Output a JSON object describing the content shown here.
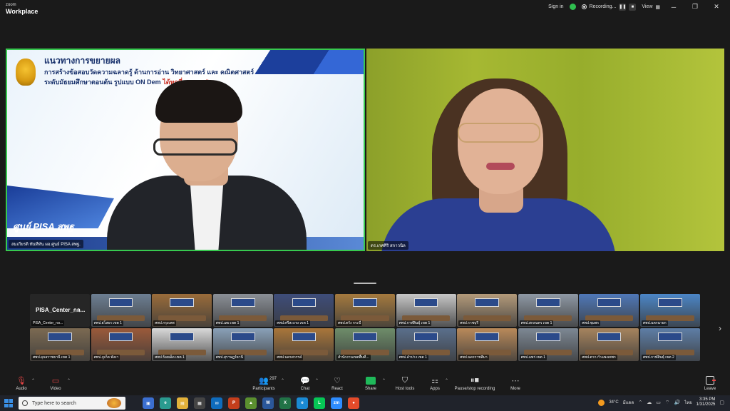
{
  "window": {
    "brand_small": "zoom",
    "brand_large": "Workplace",
    "sign_in": "Sign in",
    "recording": "Recording...",
    "view": "View"
  },
  "main_tiles": [
    {
      "slide_title": "แนวทางการขยายผล",
      "slide_line2": "การสร้างข้อสอบวัดความฉลาดรู้ ด้านการอ่าน วิทยาศาสตร์ และ คณิตศาสตร์",
      "slide_line3": "ระดับมัธยมศึกษาตอนต้น รูปแบบ ON Dem",
      "slide_line3_highlight": "ได้ทุกที่ ทุกเวลา\"",
      "slide_banner": "ศูนย์ PISA สพฐ.",
      "name": "สมเกียรติ ทันทีทัน ผอ.ศูนย์ PISA สพฐ."
    },
    {
      "name": "ดร.เกศศิริ สกาวนิล"
    }
  ],
  "gallery": [
    {
      "label": "PISA_Center_กล...",
      "text_only": true,
      "name": "PISA_Center_กล..."
    },
    {
      "label": "ศพป.ยโสธร เขต 1",
      "color": "#6d7f93"
    },
    {
      "label": "ศพป.กรุงเทพ",
      "color": "#9a6c3a"
    },
    {
      "label": "ศพป.เลย เขต 1",
      "color": "#8a8f96"
    },
    {
      "label": "ศพป.ศรีสะเกษ เขต 1",
      "color": "#3e4d7a"
    },
    {
      "label": "ศพป.ตรัง กระบี่",
      "color": "#a57a3e"
    },
    {
      "label": "ศพป.กาฬสินธุ์ เขต 1",
      "color": "#c6c6c6"
    },
    {
      "label": "ศพป.ราชบุรี",
      "color": "#b39a7a"
    },
    {
      "label": "ศพป.สกลนคร เขต 1",
      "color": "#8e98a4"
    },
    {
      "label": "ศพป.ชุมพร",
      "color": "#4f78b8"
    },
    {
      "label": "ศพป.นครนายก",
      "color": "#4b86c7"
    },
    {
      "label": "ศพป.อุบลราชธานี เขต 1",
      "color": "#7c6a52"
    },
    {
      "label": "ศพป.ภูเก็ต พังงา",
      "color": "#9b5a3a"
    },
    {
      "label": "ศพป.ร้อยเอ็ด เขต 1",
      "color": "#d9d9d9"
    },
    {
      "label": "ศพป.สุราษฎร์ธานี",
      "color": "#8aa1b8"
    },
    {
      "label": "ศพป.นครสวรรค์",
      "color": "#a9763a"
    },
    {
      "label": "สำนักงานเขตพื้นที่...",
      "color": "#6e8d6a"
    },
    {
      "label": "ศพป.ลำปาง เขต 1",
      "color": "#5a6f8c"
    },
    {
      "label": "ศพป.นครราชสีมา",
      "color": "#b98a5a"
    },
    {
      "label": "ศพป.แพร่ เขต 1",
      "color": "#7d8894"
    },
    {
      "label": "ศพป.ตาก กำแพงเพชร",
      "color": "#a6845e"
    },
    {
      "label": "ศพป.กาฬสินธุ์ เขต 2",
      "color": "#5e7ea6"
    }
  ],
  "toolbar": {
    "audio": "Audio",
    "video": "Video",
    "participants": "Participants",
    "participants_count": "297",
    "chat": "Chat",
    "react": "React",
    "share": "Share",
    "host_tools": "Host tools",
    "apps": "Apps",
    "pause_recording": "Pause/stop recording",
    "more": "More",
    "leave": "Leave"
  },
  "taskbar": {
    "search_placeholder": "Type here to search",
    "temperature": "34°C",
    "weather_text": "มีแดด",
    "language": "ไทย",
    "time": "3:35 PM",
    "date": "1/31/2025"
  }
}
